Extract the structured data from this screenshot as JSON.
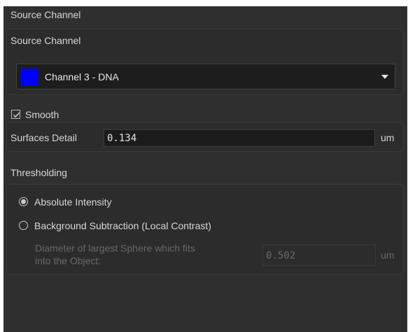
{
  "header": {
    "title": "Source Channel"
  },
  "source_channel": {
    "label": "Source Channel",
    "selected": "Channel 3 - DNA",
    "swatch_color": "#0000ff"
  },
  "smooth": {
    "label": "Smooth",
    "checked": true
  },
  "surfaces_detail": {
    "label": "Surfaces Detail",
    "value": "0.134",
    "unit": "um"
  },
  "thresholding": {
    "label": "Thresholding",
    "absolute_label": "Absolute Intensity",
    "background_label": "Background Subtraction (Local Contrast)",
    "selected": "absolute",
    "diameter_label_line1": "Diameter of largest Sphere which fits",
    "diameter_label_line2": "into the Object:",
    "diameter_value": "0.502",
    "diameter_unit": "um"
  }
}
